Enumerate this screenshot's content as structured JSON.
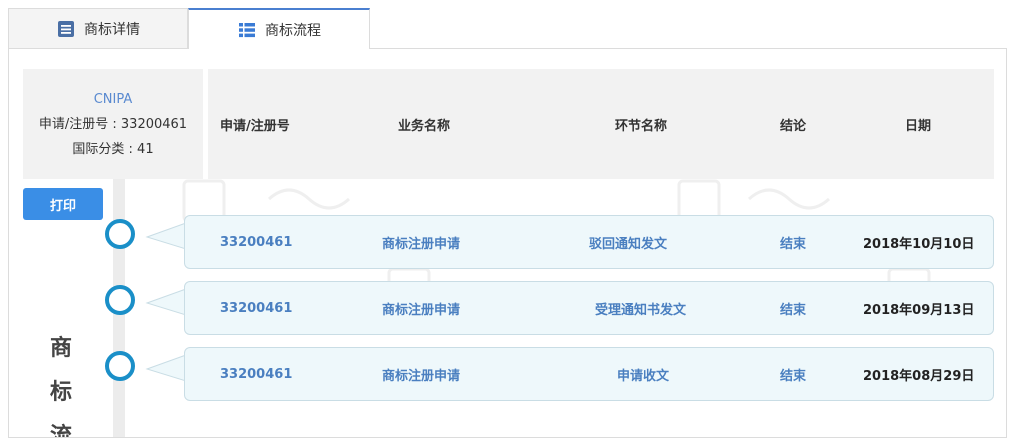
{
  "tabs": [
    {
      "label": "商标详情",
      "icon": "document-list-icon"
    },
    {
      "label": "商标流程",
      "icon": "grid-list-icon"
    }
  ],
  "info": {
    "org": "CNIPA",
    "reg_label": "申请/注册号 : 33200461",
    "class_label": "国际分类 : 41"
  },
  "table_headers": [
    "申请/注册号",
    "业务名称",
    "环节名称",
    "结论",
    "日期"
  ],
  "print_label": "打印",
  "vertical_title": [
    "商",
    "标",
    "流"
  ],
  "rows": [
    {
      "reg_no": "33200461",
      "business": "商标注册申请",
      "step": "驳回通知发文",
      "result": "结束",
      "date": "2018年10月10日"
    },
    {
      "reg_no": "33200461",
      "business": "商标注册申请",
      "step": "受理通知书发文",
      "result": "结束",
      "date": "2018年09月13日"
    },
    {
      "reg_no": "33200461",
      "business": "商标注册申请",
      "step": "申请收文",
      "result": "结束",
      "date": "2018年08月29日"
    }
  ],
  "colors": {
    "accent": "#3a8ee6",
    "timeline_node": "#1a8fc8",
    "link_text": "#4a7fc0"
  }
}
